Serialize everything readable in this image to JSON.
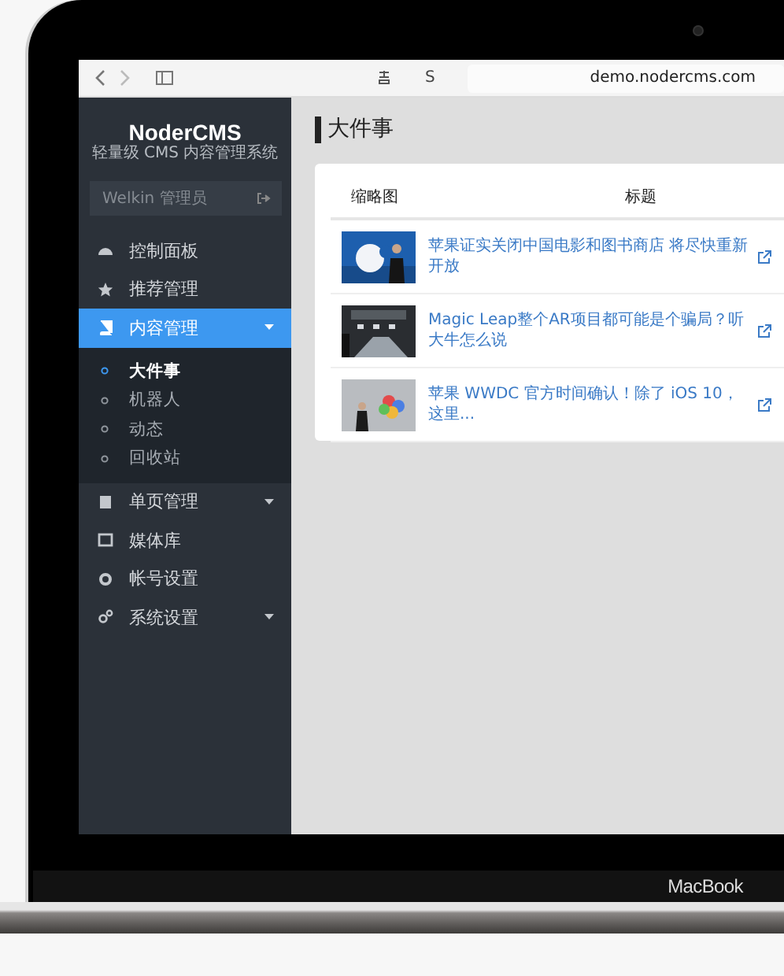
{
  "browser": {
    "extension_label": "S",
    "address": "demo.nodercms.com"
  },
  "sidebar": {
    "logo": "NoderCMS",
    "tagline": "轻量级 CMS 内容管理系统",
    "user": "Welkin 管理员",
    "menu": [
      {
        "label": "控制面板",
        "selected": false,
        "expandable": false
      },
      {
        "label": "推荐管理",
        "selected": false,
        "expandable": false
      },
      {
        "label": "内容管理",
        "selected": true,
        "expandable": true,
        "expanded": true,
        "children": [
          {
            "label": "大件事",
            "selected": true
          },
          {
            "label": "机器人",
            "selected": false
          },
          {
            "label": "动态",
            "selected": false
          },
          {
            "label": "回收站",
            "selected": false
          }
        ]
      },
      {
        "label": "单页管理",
        "selected": false,
        "expandable": true,
        "expanded": false
      },
      {
        "label": "媒体库",
        "selected": false,
        "expandable": false
      },
      {
        "label": "帐号设置",
        "selected": false,
        "expandable": false
      },
      {
        "label": "系统设置",
        "selected": false,
        "expandable": true,
        "expanded": false
      }
    ]
  },
  "content": {
    "title": "大件事",
    "table": {
      "columns": [
        "缩略图",
        "标题"
      ],
      "rows": [
        {
          "title": "苹果证实关闭中国电影和图书商店 将尽快重新开放"
        },
        {
          "title": "Magic Leap整个AR项目都可能是个骗局？听大牛怎么说"
        },
        {
          "title": "苹果 WWDC 官方时间确认！除了 iOS 10，这里..."
        }
      ]
    }
  },
  "device": {
    "label": "MacBook"
  }
}
